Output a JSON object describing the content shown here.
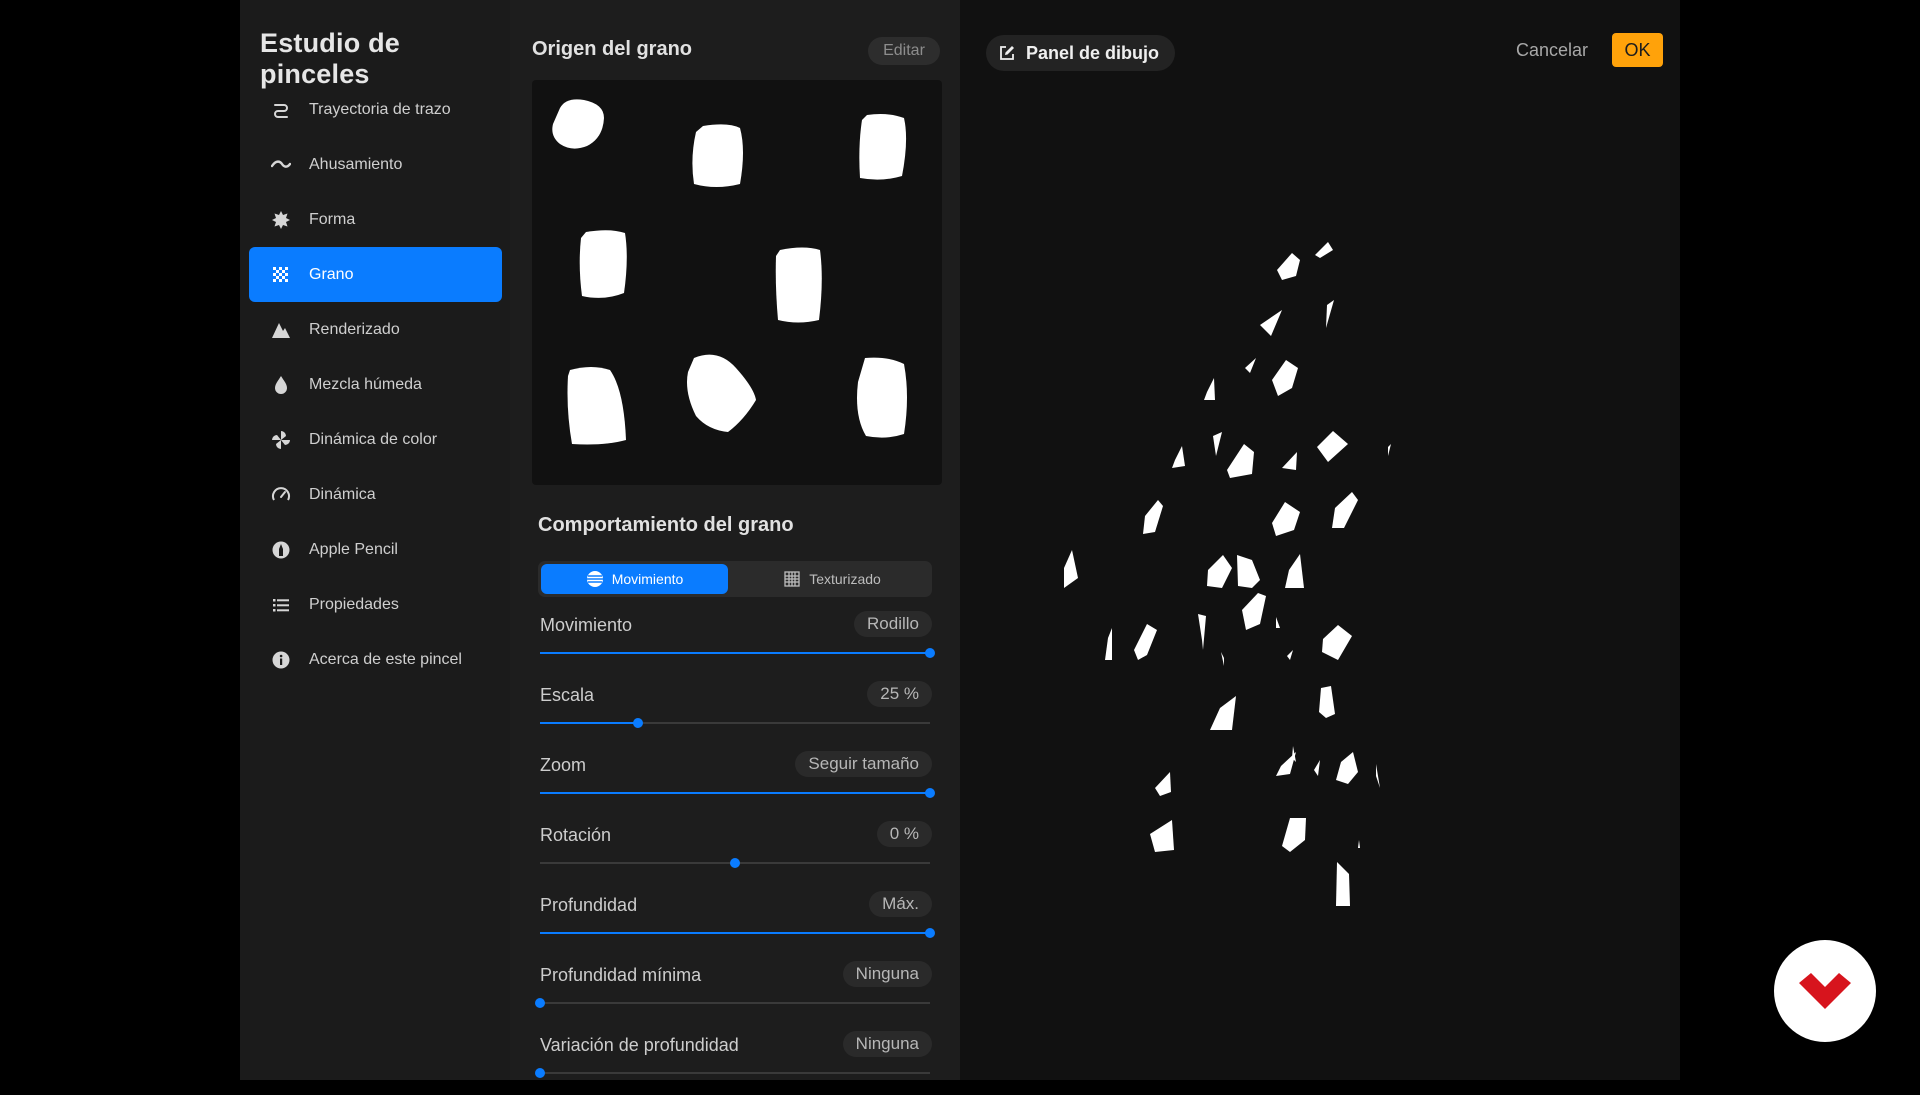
{
  "sidebar": {
    "title": "Estudio de pinceles",
    "items": [
      {
        "label": "Trayectoria de trazo",
        "icon": "stroke-path-icon"
      },
      {
        "label": "Ahusamiento",
        "icon": "taper-icon"
      },
      {
        "label": "Forma",
        "icon": "shape-icon"
      },
      {
        "label": "Grano",
        "icon": "grain-icon",
        "active": true
      },
      {
        "label": "Renderizado",
        "icon": "rendering-icon"
      },
      {
        "label": "Mezcla húmeda",
        "icon": "wet-mix-icon"
      },
      {
        "label": "Dinámica de color",
        "icon": "color-dynamics-icon"
      },
      {
        "label": "Dinámica",
        "icon": "dynamics-icon"
      },
      {
        "label": "Apple Pencil",
        "icon": "apple-pencil-icon"
      },
      {
        "label": "Propiedades",
        "icon": "properties-icon"
      },
      {
        "label": "Acerca de este pincel",
        "icon": "info-icon"
      }
    ]
  },
  "grain_source": {
    "title": "Origen del grano",
    "edit_label": "Editar"
  },
  "grain_behavior": {
    "title": "Comportamiento del grano",
    "segments": {
      "movement": "Movimiento",
      "textured": "Texturizado",
      "selected": "Movimiento"
    },
    "settings": [
      {
        "label": "Movimiento",
        "value": "Rodillo",
        "fraction": 1.0
      },
      {
        "label": "Escala",
        "value": "25 %",
        "fraction": 0.25
      },
      {
        "label": "Zoom",
        "value": "Seguir tamaño",
        "fraction": 1.0
      },
      {
        "label": "Rotación",
        "value": "0 %",
        "fraction": 0.5
      },
      {
        "label": "Profundidad",
        "value": "Máx.",
        "fraction": 1.0
      },
      {
        "label": "Profundidad mínima",
        "value": "Ninguna",
        "fraction": 0.0
      },
      {
        "label": "Variación de profundidad",
        "value": "Ninguna",
        "fraction": 0.0
      }
    ]
  },
  "drawing_pad": {
    "label": "Panel de dibujo",
    "cancel_label": "Cancelar",
    "ok_label": "OK"
  },
  "colors": {
    "accent": "#0a7cff",
    "ok_button": "#ffa20a",
    "logo_red": "#d7141d"
  }
}
